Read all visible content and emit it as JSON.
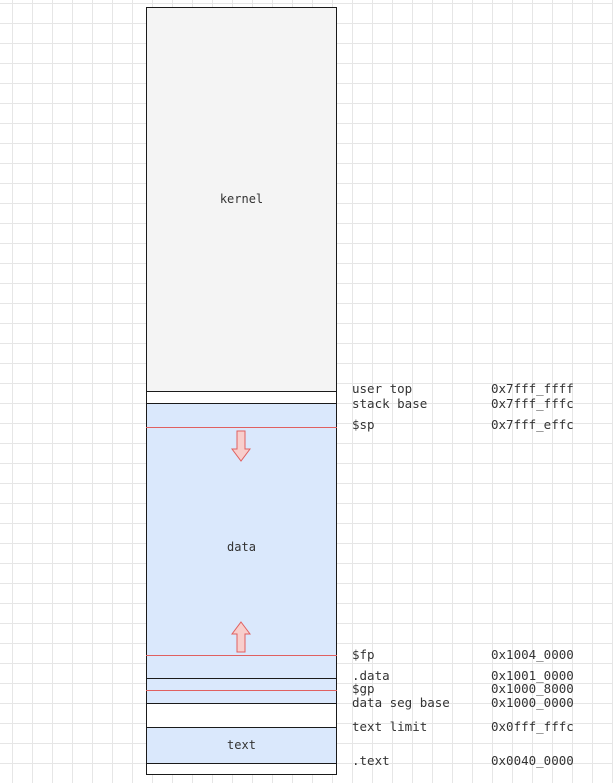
{
  "regions": {
    "kernel": "kernel",
    "data": "data",
    "text": "text"
  },
  "addresses": [
    {
      "label": "user top",
      "value": "0x7fff_ffff"
    },
    {
      "label": "stack base",
      "value": "0x7fff_fffc"
    },
    {
      "label": "$sp",
      "value": "0x7fff_effc"
    },
    {
      "label": "$fp",
      "value": "0x1004_0000"
    },
    {
      "label": ".data",
      "value": "0x1001_0000"
    },
    {
      "label": "$gp",
      "value": "0x1000_8000"
    },
    {
      "label": "data seg base",
      "value": "0x1000_0000"
    },
    {
      "label": "text limit",
      "value": "0x0fff_fffc"
    },
    {
      "label": ".text",
      "value": "0x0040_0000"
    }
  ],
  "colors": {
    "kernel_fill": "#f4f4f4",
    "segment_fill": "#dae8fc",
    "border": "#1a1a1a",
    "pointer_line": "#e06060",
    "arrow_fill": "#f8cecc",
    "arrow_stroke": "#e06060",
    "grid": "#e6e6e6"
  },
  "icons": {
    "stack_growth": "arrow-down",
    "heap_growth": "arrow-up"
  }
}
